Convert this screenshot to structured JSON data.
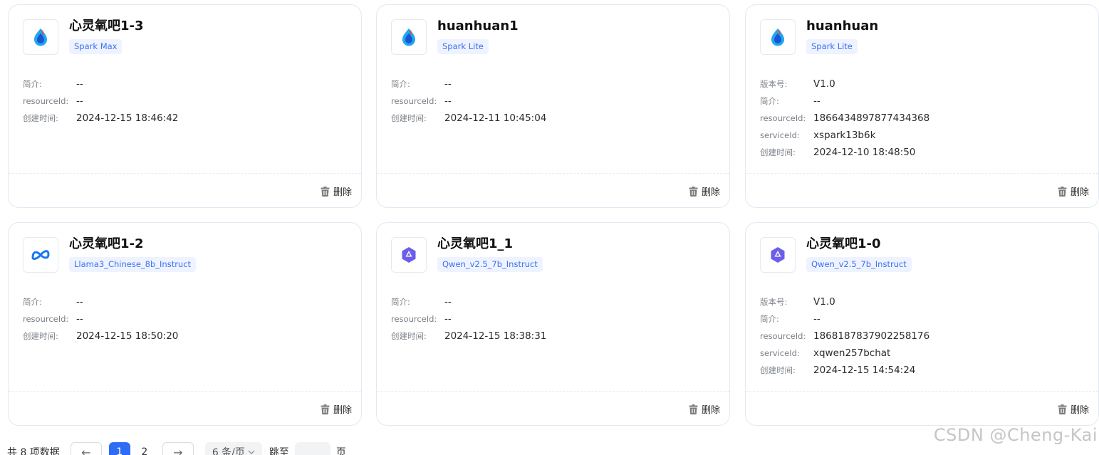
{
  "cards": [
    {
      "title": "心灵氧吧1-3",
      "model": "Spark Max",
      "logo": "spark-logo-icon",
      "rows": [
        {
          "label": "简介:",
          "value": "--"
        },
        {
          "label": "resourceId:",
          "value": "--"
        },
        {
          "label": "创建时间:",
          "value": "2024-12-15 18:46:42"
        }
      ],
      "delete_label": "删除"
    },
    {
      "title": "huanhuan1",
      "model": "Spark Lite",
      "logo": "spark-logo-icon",
      "rows": [
        {
          "label": "简介:",
          "value": "--"
        },
        {
          "label": "resourceId:",
          "value": "--"
        },
        {
          "label": "创建时间:",
          "value": "2024-12-11 10:45:04"
        }
      ],
      "delete_label": "删除"
    },
    {
      "title": "huanhuan",
      "model": "Spark Lite",
      "logo": "spark-logo-icon",
      "rows": [
        {
          "label": "版本号:",
          "value": "V1.0"
        },
        {
          "label": "简介:",
          "value": "--"
        },
        {
          "label": "resourceId:",
          "value": "1866434897877434368"
        },
        {
          "label": "serviceId:",
          "value": "xspark13b6k"
        },
        {
          "label": "创建时间:",
          "value": "2024-12-10 18:48:50"
        }
      ],
      "delete_label": "删除"
    },
    {
      "title": "心灵氧吧1-2",
      "model": "Llama3_Chinese_8b_Instruct",
      "logo": "meta-logo-icon",
      "rows": [
        {
          "label": "简介:",
          "value": "--"
        },
        {
          "label": "resourceId:",
          "value": "--"
        },
        {
          "label": "创建时间:",
          "value": "2024-12-15 18:50:20"
        }
      ],
      "delete_label": "删除"
    },
    {
      "title": "心灵氧吧1_1",
      "model": "Qwen_v2.5_7b_Instruct",
      "logo": "qwen-logo-icon",
      "rows": [
        {
          "label": "简介:",
          "value": "--"
        },
        {
          "label": "resourceId:",
          "value": "--"
        },
        {
          "label": "创建时间:",
          "value": "2024-12-15 18:38:31"
        }
      ],
      "delete_label": "删除"
    },
    {
      "title": "心灵氧吧1-0",
      "model": "Qwen_v2.5_7b_Instruct",
      "logo": "qwen-logo-icon",
      "rows": [
        {
          "label": "版本号:",
          "value": "V1.0"
        },
        {
          "label": "简介:",
          "value": "--"
        },
        {
          "label": "resourceId:",
          "value": "1868187837902258176"
        },
        {
          "label": "serviceId:",
          "value": "xqwen257bchat"
        },
        {
          "label": "创建时间:",
          "value": "2024-12-15 14:54:24"
        }
      ],
      "delete_label": "删除"
    }
  ],
  "pagination": {
    "total_text": "共 8 项数据",
    "prev_icon": "←",
    "next_icon": "→",
    "pages": [
      "1",
      "2"
    ],
    "current_page": "1",
    "page_size": "6 条/页",
    "jump_label": "跳至",
    "page_suffix": "页"
  },
  "watermark": "CSDN @Cheng-Kai",
  "colors": {
    "accent": "#2e6cf6",
    "tag_bg": "#eef3ff",
    "tag_text": "#3b72f0"
  }
}
